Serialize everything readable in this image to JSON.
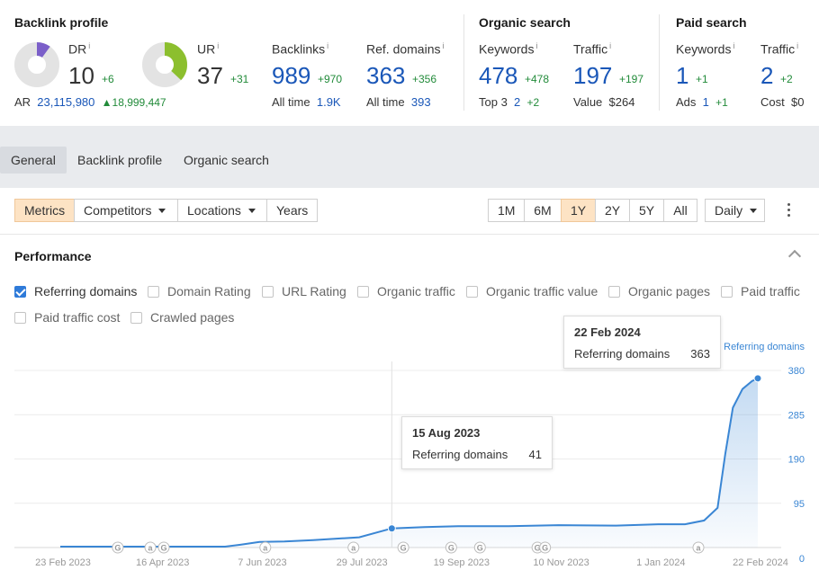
{
  "sections": {
    "backlink_profile": "Backlink profile",
    "organic_search": "Organic search",
    "paid_search": "Paid search"
  },
  "metrics": {
    "dr": {
      "label": "DR",
      "value": "10",
      "delta": "+6",
      "fill": 0.1,
      "color": "#7b5fc9"
    },
    "ur": {
      "label": "UR",
      "value": "37",
      "delta": "+31",
      "fill": 0.37,
      "color": "#8cbf2e"
    },
    "ar": {
      "label": "AR",
      "value": "23,115,980",
      "delta": "18,999,447"
    },
    "backlinks": {
      "label": "Backlinks",
      "value": "989",
      "delta": "+970",
      "sub_label": "All time",
      "sub_value": "1.9K"
    },
    "ref_domains": {
      "label": "Ref. domains",
      "value": "363",
      "delta": "+356",
      "sub_label": "All time",
      "sub_value": "393"
    },
    "org_keywords": {
      "label": "Keywords",
      "value": "478",
      "delta": "+478",
      "sub_label": "Top 3",
      "sub_value": "2",
      "sub_delta": "+2"
    },
    "org_traffic": {
      "label": "Traffic",
      "value": "197",
      "delta": "+197",
      "sub_label": "Value",
      "sub_value": "$264"
    },
    "paid_keywords": {
      "label": "Keywords",
      "value": "1",
      "delta": "+1",
      "sub_label": "Ads",
      "sub_value": "1",
      "sub_delta": "+1"
    },
    "paid_traffic": {
      "label": "Traffic",
      "value": "2",
      "delta": "+2",
      "sub_label": "Cost",
      "sub_value": "$0"
    }
  },
  "info_mark": "i",
  "tabs": [
    "General",
    "Backlink profile",
    "Organic search"
  ],
  "active_tab": "General",
  "toolbar": {
    "metrics": "Metrics",
    "competitors": "Competitors",
    "locations": "Locations",
    "years": "Years",
    "ranges": [
      "1M",
      "6M",
      "1Y",
      "2Y",
      "5Y",
      "All"
    ],
    "selected_range": "1Y",
    "interval": "Daily"
  },
  "performance": {
    "title": "Performance",
    "checkboxes": [
      {
        "label": "Referring domains",
        "checked": true
      },
      {
        "label": "Domain Rating",
        "checked": false
      },
      {
        "label": "URL Rating",
        "checked": false
      },
      {
        "label": "Organic traffic",
        "checked": false
      },
      {
        "label": "Organic traffic value",
        "checked": false
      },
      {
        "label": "Organic pages",
        "checked": false
      },
      {
        "label": "Paid traffic",
        "checked": false
      },
      {
        "label": "Paid traffic cost",
        "checked": false
      },
      {
        "label": "Crawled pages",
        "checked": false
      }
    ]
  },
  "chart_data": {
    "type": "area",
    "series": [
      {
        "name": "Referring domains",
        "color": "#3a86d4"
      }
    ],
    "x_ticks": [
      "23 Feb 2023",
      "16 Apr 2023",
      "7 Jun 2023",
      "29 Jul 2023",
      "19 Sep 2023",
      "10 Nov 2023",
      "1 Jan 2024",
      "22 Feb 2024"
    ],
    "y_ticks": [
      0,
      95,
      190,
      285,
      380
    ],
    "ylim": [
      0,
      380
    ],
    "points": [
      [
        "2023-02-23",
        2
      ],
      [
        "2023-03-15",
        2
      ],
      [
        "2023-04-16",
        2
      ],
      [
        "2023-05-20",
        2
      ],
      [
        "2023-05-28",
        6
      ],
      [
        "2023-06-07",
        12
      ],
      [
        "2023-06-20",
        13
      ],
      [
        "2023-07-05",
        16
      ],
      [
        "2023-07-29",
        22
      ],
      [
        "2023-08-15",
        41
      ],
      [
        "2023-09-01",
        44
      ],
      [
        "2023-09-19",
        46
      ],
      [
        "2023-10-15",
        46
      ],
      [
        "2023-11-10",
        48
      ],
      [
        "2023-12-10",
        47
      ],
      [
        "2024-01-01",
        50
      ],
      [
        "2024-01-15",
        50
      ],
      [
        "2024-01-25",
        58
      ],
      [
        "2024-02-01",
        85
      ],
      [
        "2024-02-05",
        200
      ],
      [
        "2024-02-09",
        300
      ],
      [
        "2024-02-14",
        340
      ],
      [
        "2024-02-19",
        357
      ],
      [
        "2024-02-22",
        363
      ]
    ],
    "annotations": [
      {
        "date": "2023-03-25",
        "kind": "G"
      },
      {
        "date": "2023-04-11",
        "kind": "a"
      },
      {
        "date": "2023-04-18",
        "kind": "G"
      },
      {
        "date": "2023-06-10",
        "kind": "a"
      },
      {
        "date": "2023-07-26",
        "kind": "a"
      },
      {
        "date": "2023-08-21",
        "kind": "G"
      },
      {
        "date": "2023-09-15",
        "kind": "G"
      },
      {
        "date": "2023-09-30",
        "kind": "G"
      },
      {
        "date": "2023-10-30",
        "kind": "G"
      },
      {
        "date": "2023-11-03",
        "kind": "G"
      },
      {
        "date": "2024-01-22",
        "kind": "a"
      }
    ],
    "tooltips": [
      {
        "date_label": "22 Feb 2024",
        "series": "Referring domains",
        "value": "363",
        "date": "2024-02-22"
      },
      {
        "date_label": "15 Aug 2023",
        "series": "Referring domains",
        "value": "41",
        "date": "2023-08-15"
      }
    ],
    "grid": true
  }
}
